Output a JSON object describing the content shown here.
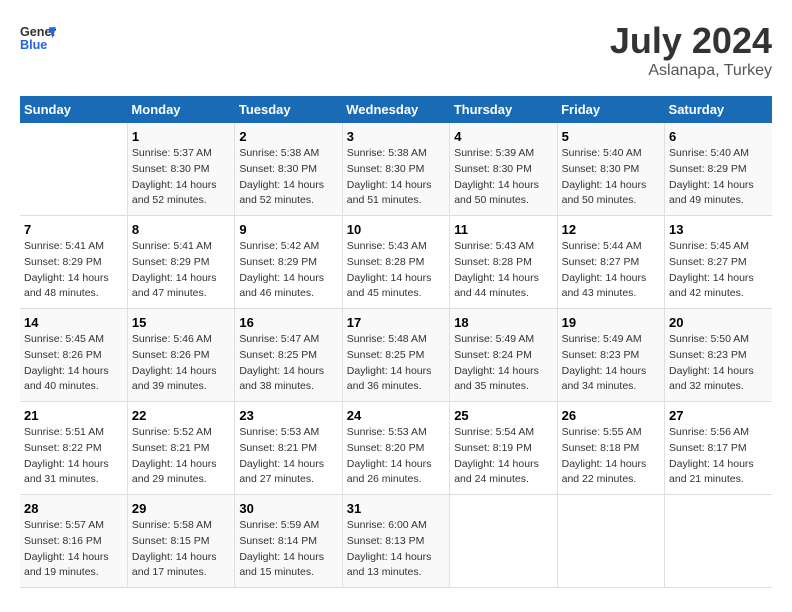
{
  "header": {
    "logo_general": "General",
    "logo_blue": "Blue",
    "title": "July 2024",
    "subtitle": "Aslanapa, Turkey"
  },
  "days_of_week": [
    "Sunday",
    "Monday",
    "Tuesday",
    "Wednesday",
    "Thursday",
    "Friday",
    "Saturday"
  ],
  "weeks": [
    [
      {
        "num": "",
        "sunrise": "",
        "sunset": "",
        "daylight": ""
      },
      {
        "num": "1",
        "sunrise": "Sunrise: 5:37 AM",
        "sunset": "Sunset: 8:30 PM",
        "daylight": "Daylight: 14 hours and 52 minutes."
      },
      {
        "num": "2",
        "sunrise": "Sunrise: 5:38 AM",
        "sunset": "Sunset: 8:30 PM",
        "daylight": "Daylight: 14 hours and 52 minutes."
      },
      {
        "num": "3",
        "sunrise": "Sunrise: 5:38 AM",
        "sunset": "Sunset: 8:30 PM",
        "daylight": "Daylight: 14 hours and 51 minutes."
      },
      {
        "num": "4",
        "sunrise": "Sunrise: 5:39 AM",
        "sunset": "Sunset: 8:30 PM",
        "daylight": "Daylight: 14 hours and 50 minutes."
      },
      {
        "num": "5",
        "sunrise": "Sunrise: 5:40 AM",
        "sunset": "Sunset: 8:30 PM",
        "daylight": "Daylight: 14 hours and 50 minutes."
      },
      {
        "num": "6",
        "sunrise": "Sunrise: 5:40 AM",
        "sunset": "Sunset: 8:29 PM",
        "daylight": "Daylight: 14 hours and 49 minutes."
      }
    ],
    [
      {
        "num": "7",
        "sunrise": "Sunrise: 5:41 AM",
        "sunset": "Sunset: 8:29 PM",
        "daylight": "Daylight: 14 hours and 48 minutes."
      },
      {
        "num": "8",
        "sunrise": "Sunrise: 5:41 AM",
        "sunset": "Sunset: 8:29 PM",
        "daylight": "Daylight: 14 hours and 47 minutes."
      },
      {
        "num": "9",
        "sunrise": "Sunrise: 5:42 AM",
        "sunset": "Sunset: 8:29 PM",
        "daylight": "Daylight: 14 hours and 46 minutes."
      },
      {
        "num": "10",
        "sunrise": "Sunrise: 5:43 AM",
        "sunset": "Sunset: 8:28 PM",
        "daylight": "Daylight: 14 hours and 45 minutes."
      },
      {
        "num": "11",
        "sunrise": "Sunrise: 5:43 AM",
        "sunset": "Sunset: 8:28 PM",
        "daylight": "Daylight: 14 hours and 44 minutes."
      },
      {
        "num": "12",
        "sunrise": "Sunrise: 5:44 AM",
        "sunset": "Sunset: 8:27 PM",
        "daylight": "Daylight: 14 hours and 43 minutes."
      },
      {
        "num": "13",
        "sunrise": "Sunrise: 5:45 AM",
        "sunset": "Sunset: 8:27 PM",
        "daylight": "Daylight: 14 hours and 42 minutes."
      }
    ],
    [
      {
        "num": "14",
        "sunrise": "Sunrise: 5:45 AM",
        "sunset": "Sunset: 8:26 PM",
        "daylight": "Daylight: 14 hours and 40 minutes."
      },
      {
        "num": "15",
        "sunrise": "Sunrise: 5:46 AM",
        "sunset": "Sunset: 8:26 PM",
        "daylight": "Daylight: 14 hours and 39 minutes."
      },
      {
        "num": "16",
        "sunrise": "Sunrise: 5:47 AM",
        "sunset": "Sunset: 8:25 PM",
        "daylight": "Daylight: 14 hours and 38 minutes."
      },
      {
        "num": "17",
        "sunrise": "Sunrise: 5:48 AM",
        "sunset": "Sunset: 8:25 PM",
        "daylight": "Daylight: 14 hours and 36 minutes."
      },
      {
        "num": "18",
        "sunrise": "Sunrise: 5:49 AM",
        "sunset": "Sunset: 8:24 PM",
        "daylight": "Daylight: 14 hours and 35 minutes."
      },
      {
        "num": "19",
        "sunrise": "Sunrise: 5:49 AM",
        "sunset": "Sunset: 8:23 PM",
        "daylight": "Daylight: 14 hours and 34 minutes."
      },
      {
        "num": "20",
        "sunrise": "Sunrise: 5:50 AM",
        "sunset": "Sunset: 8:23 PM",
        "daylight": "Daylight: 14 hours and 32 minutes."
      }
    ],
    [
      {
        "num": "21",
        "sunrise": "Sunrise: 5:51 AM",
        "sunset": "Sunset: 8:22 PM",
        "daylight": "Daylight: 14 hours and 31 minutes."
      },
      {
        "num": "22",
        "sunrise": "Sunrise: 5:52 AM",
        "sunset": "Sunset: 8:21 PM",
        "daylight": "Daylight: 14 hours and 29 minutes."
      },
      {
        "num": "23",
        "sunrise": "Sunrise: 5:53 AM",
        "sunset": "Sunset: 8:21 PM",
        "daylight": "Daylight: 14 hours and 27 minutes."
      },
      {
        "num": "24",
        "sunrise": "Sunrise: 5:53 AM",
        "sunset": "Sunset: 8:20 PM",
        "daylight": "Daylight: 14 hours and 26 minutes."
      },
      {
        "num": "25",
        "sunrise": "Sunrise: 5:54 AM",
        "sunset": "Sunset: 8:19 PM",
        "daylight": "Daylight: 14 hours and 24 minutes."
      },
      {
        "num": "26",
        "sunrise": "Sunrise: 5:55 AM",
        "sunset": "Sunset: 8:18 PM",
        "daylight": "Daylight: 14 hours and 22 minutes."
      },
      {
        "num": "27",
        "sunrise": "Sunrise: 5:56 AM",
        "sunset": "Sunset: 8:17 PM",
        "daylight": "Daylight: 14 hours and 21 minutes."
      }
    ],
    [
      {
        "num": "28",
        "sunrise": "Sunrise: 5:57 AM",
        "sunset": "Sunset: 8:16 PM",
        "daylight": "Daylight: 14 hours and 19 minutes."
      },
      {
        "num": "29",
        "sunrise": "Sunrise: 5:58 AM",
        "sunset": "Sunset: 8:15 PM",
        "daylight": "Daylight: 14 hours and 17 minutes."
      },
      {
        "num": "30",
        "sunrise": "Sunrise: 5:59 AM",
        "sunset": "Sunset: 8:14 PM",
        "daylight": "Daylight: 14 hours and 15 minutes."
      },
      {
        "num": "31",
        "sunrise": "Sunrise: 6:00 AM",
        "sunset": "Sunset: 8:13 PM",
        "daylight": "Daylight: 14 hours and 13 minutes."
      },
      {
        "num": "",
        "sunrise": "",
        "sunset": "",
        "daylight": ""
      },
      {
        "num": "",
        "sunrise": "",
        "sunset": "",
        "daylight": ""
      },
      {
        "num": "",
        "sunrise": "",
        "sunset": "",
        "daylight": ""
      }
    ]
  ]
}
